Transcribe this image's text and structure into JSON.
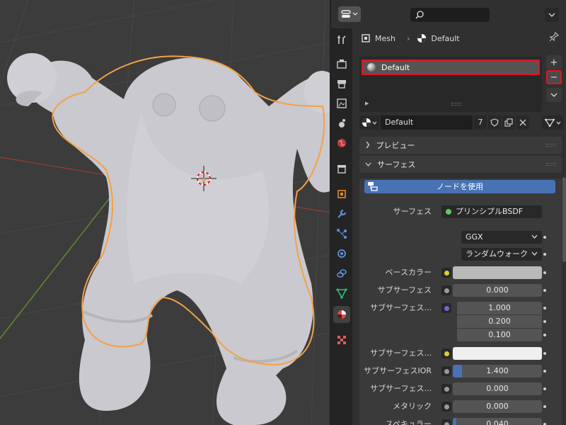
{
  "breadcrumb": {
    "object": "Mesh",
    "material": "Default"
  },
  "material_slots": [
    {
      "name": "Default",
      "selected": true
    }
  ],
  "slot_buttons": {
    "add": "+",
    "remove": "−",
    "menu": "⌄"
  },
  "material_selector": {
    "name": "Default",
    "users": "7"
  },
  "sections": {
    "preview": "プレビュー",
    "surface": "サーフェス"
  },
  "surface": {
    "use_nodes_label": "ノードを使用",
    "surface_label": "サーフェス",
    "surface_value": "プリンシプルBSDF",
    "distribution": "GGX",
    "subsurface_method": "ランダムウォーク",
    "props": [
      {
        "label": "ベースカラー",
        "type": "color",
        "color": "#b9b9b9",
        "socket": "#d9d02a"
      },
      {
        "label": "サブサーフェス",
        "type": "value",
        "value": "0.000",
        "fill": 0,
        "socket": "#9a9a9a"
      },
      {
        "label": "サブサーフェス...",
        "type": "vector",
        "values": [
          "1.000",
          "0.200",
          "0.100"
        ],
        "socket": "#6b6bd6"
      },
      {
        "label": "サブサーフェス...",
        "type": "color",
        "color": "#efefef",
        "socket": "#d9d02a"
      },
      {
        "label": "サブサーフェスIOR",
        "type": "value",
        "value": "1.400",
        "fill": 0.1,
        "socket": "#9a9a9a"
      },
      {
        "label": "サブサーフェス...",
        "type": "value",
        "value": "0.000",
        "fill": 0,
        "socket": "#9a9a9a"
      },
      {
        "label": "メタリック",
        "type": "value",
        "value": "0.000",
        "fill": 0,
        "socket": "#9a9a9a"
      },
      {
        "label": "スペキュラー",
        "type": "value",
        "value": "0.040",
        "fill": 0.04,
        "socket": "#9a9a9a"
      }
    ]
  },
  "colors": {
    "accent": "#4772b3",
    "highlight": "#e0141e",
    "outline": "#f5a142"
  }
}
